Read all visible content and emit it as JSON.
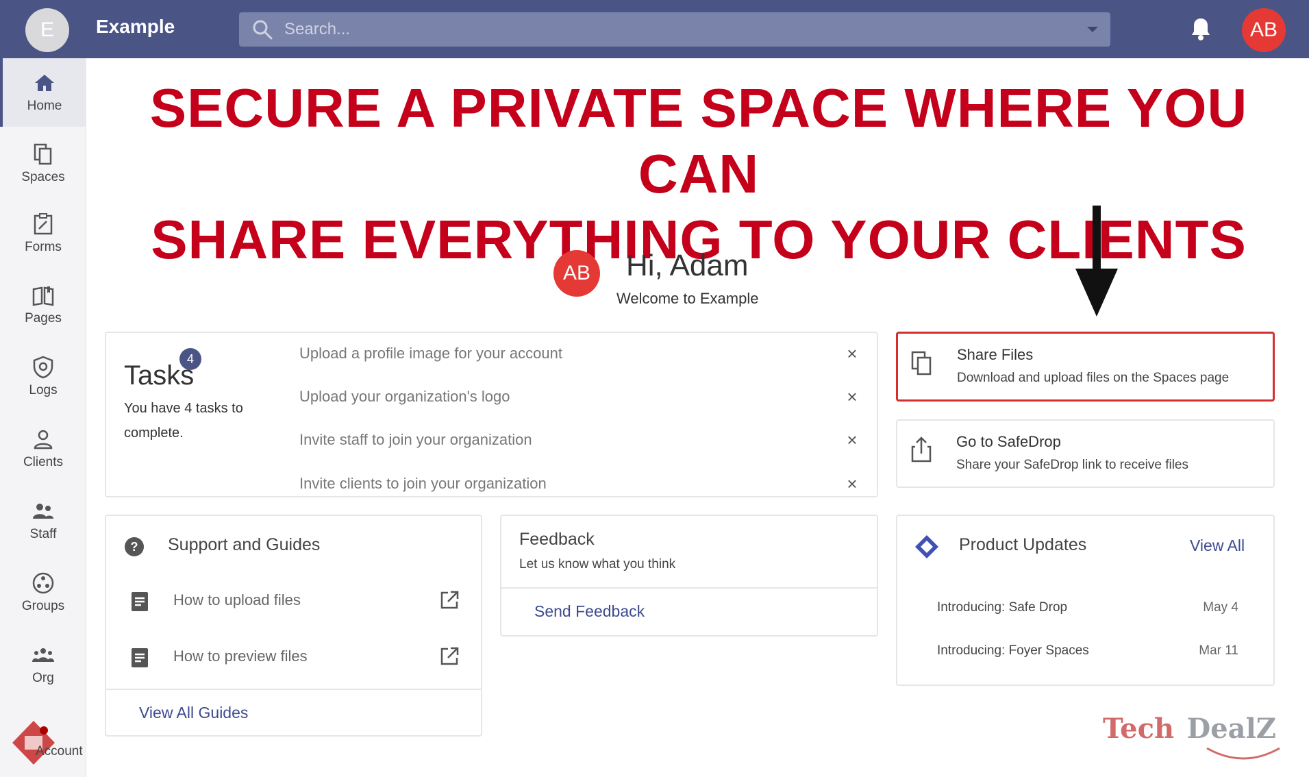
{
  "topbar": {
    "brand_initial": "E",
    "brand_name": "Example",
    "search_placeholder": "Search...",
    "user_initials": "AB"
  },
  "sidebar": {
    "items": [
      {
        "label": "Home",
        "icon": "home-icon",
        "active": true
      },
      {
        "label": "Spaces",
        "icon": "spaces-icon"
      },
      {
        "label": "Forms",
        "icon": "forms-icon"
      },
      {
        "label": "Pages",
        "icon": "pages-icon"
      },
      {
        "label": "Logs",
        "icon": "logs-icon"
      },
      {
        "label": "Clients",
        "icon": "clients-icon"
      },
      {
        "label": "Staff",
        "icon": "staff-icon"
      },
      {
        "label": "Groups",
        "icon": "groups-icon"
      },
      {
        "label": "Org",
        "icon": "org-icon"
      },
      {
        "label": "Account",
        "icon": "account-icon"
      }
    ]
  },
  "headline": {
    "line1": "SECURE A PRIVATE SPACE WHERE YOU CAN",
    "line2": "SHARE EVERYTHING TO YOUR CLIENTS"
  },
  "greeting": {
    "initials": "AB",
    "title": "Hi, Adam",
    "subtitle": "Welcome to Example"
  },
  "tasks": {
    "title": "Tasks",
    "badge": "4",
    "description": "You have 4 tasks to complete.",
    "items": [
      "Upload a profile image for your account",
      "Upload your organization's logo",
      "Invite staff to join your organization",
      "Invite clients to join your organization"
    ]
  },
  "quick_actions": [
    {
      "title": "Share Files",
      "subtitle": "Download and upload files on the Spaces page",
      "highlighted": true
    },
    {
      "title": "Go to SafeDrop",
      "subtitle": "Share your SafeDrop link to receive files"
    }
  ],
  "support": {
    "title": "Support and Guides",
    "guides": [
      "How to upload files",
      "How to preview files"
    ],
    "view_all": "View All Guides"
  },
  "feedback": {
    "title": "Feedback",
    "subtitle": "Let us know what you think",
    "action": "Send Feedback"
  },
  "updates": {
    "title": "Product Updates",
    "view_all": "View All",
    "items": [
      {
        "title": "Introducing: Safe Drop",
        "date": "May 4"
      },
      {
        "title": "Introducing: Foyer Spaces",
        "date": "Mar 11"
      }
    ]
  },
  "watermark": {
    "part1": "Tech",
    "part2": "DealZ"
  },
  "colors": {
    "accent": "#4a5586",
    "headline": "#c4001a",
    "avatar": "#e53935",
    "link": "#3d4a8f"
  }
}
